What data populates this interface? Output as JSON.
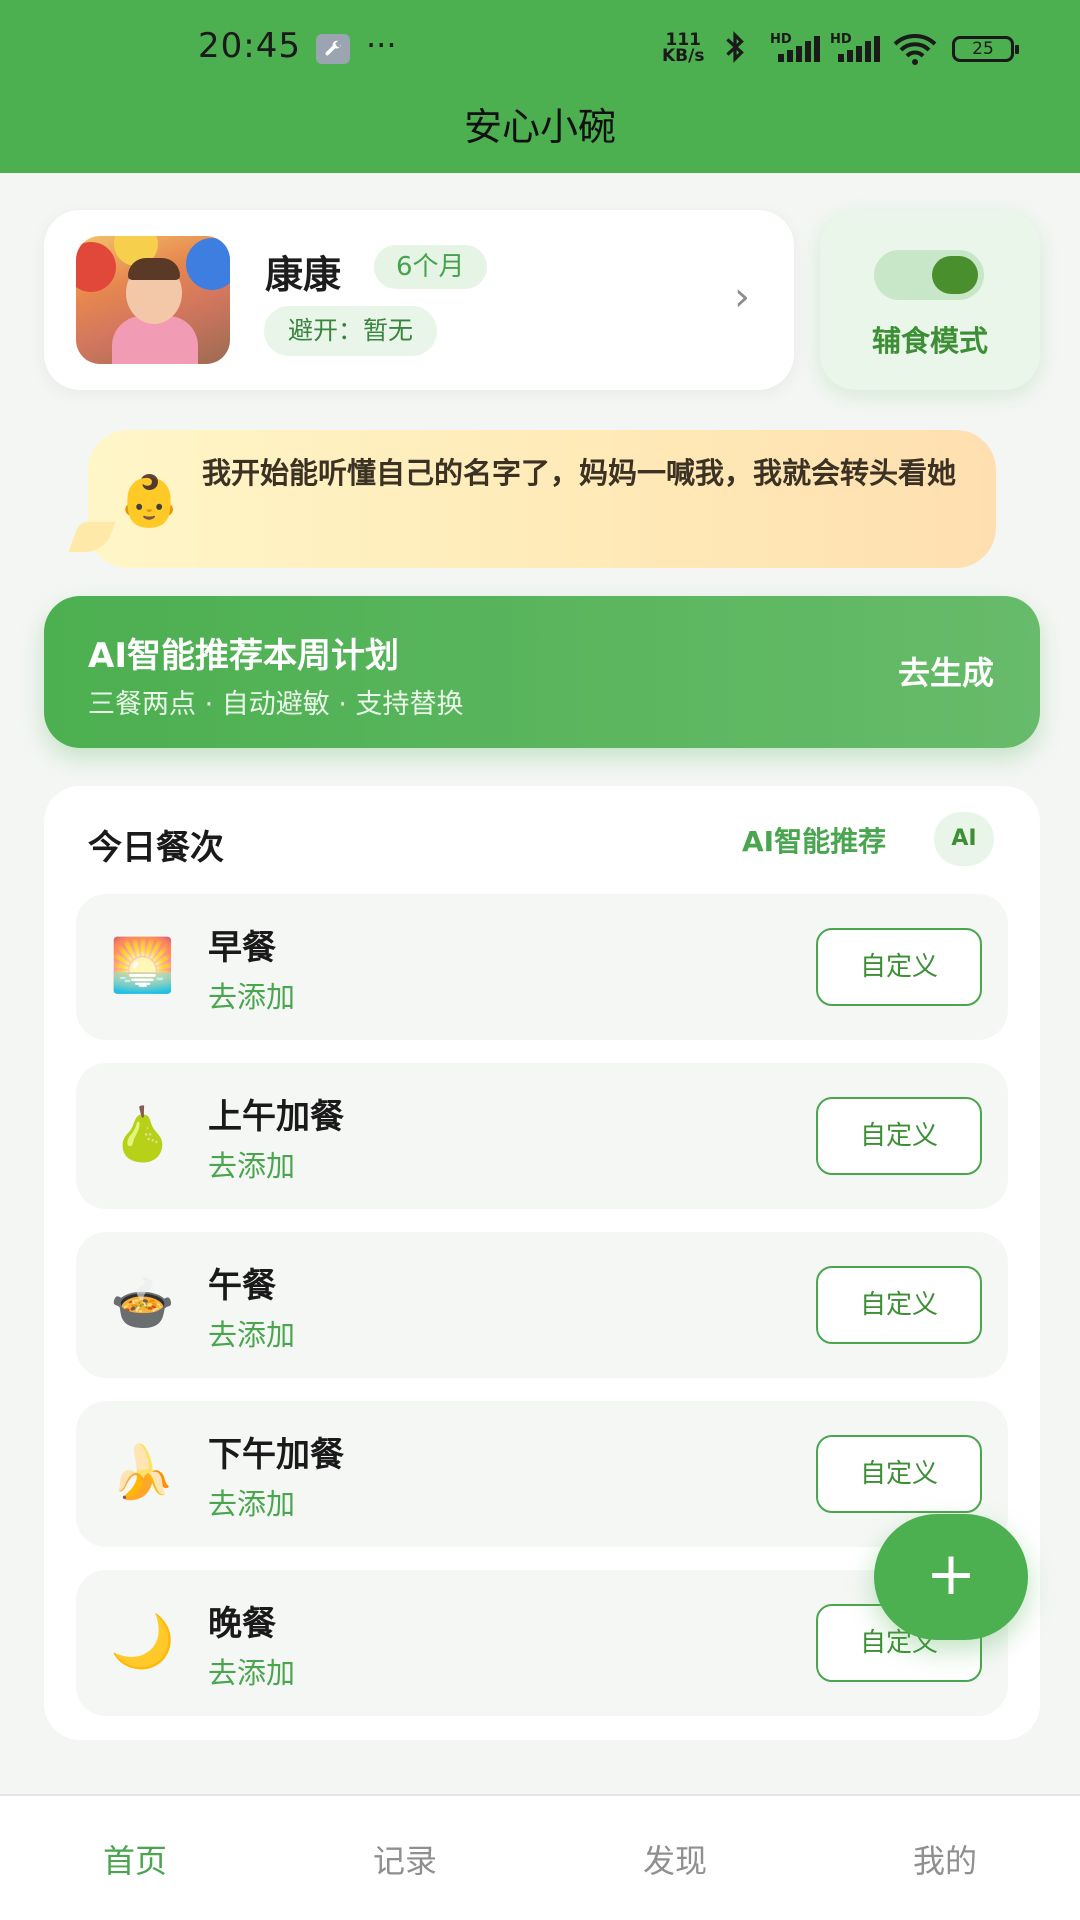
{
  "status_bar": {
    "time": "20:45",
    "more": "···",
    "net_speed_value": "111",
    "net_speed_unit": "KB/s",
    "signal_label": "HD",
    "battery": "25"
  },
  "app": {
    "title": "安心小碗"
  },
  "profile": {
    "name": "康康",
    "age": "6个月",
    "avoid": "避开：暂无",
    "chevron": "›"
  },
  "mode": {
    "label": "辅食模式",
    "enabled": true
  },
  "tip": {
    "emoji": "👶",
    "text": "我开始能听懂自己的名字了，妈妈一喊我，我就会转头看她"
  },
  "ai_banner": {
    "title": "AI智能推荐本周计划",
    "subtitle": "三餐两点 · 自动避敏 · 支持替换",
    "cta": "去生成"
  },
  "meals": {
    "heading": "今日餐次",
    "ai_link": "AI智能推荐",
    "ai_chip": "AI",
    "items": [
      {
        "icon": "🌅",
        "icon_name": "sunrise-icon",
        "name": "早餐",
        "action": "去添加",
        "custom": "自定义"
      },
      {
        "icon": "🍐",
        "icon_name": "pear-icon",
        "name": "上午加餐",
        "action": "去添加",
        "custom": "自定义"
      },
      {
        "icon": "🍲",
        "icon_name": "pot-of-food-icon",
        "name": "午餐",
        "action": "去添加",
        "custom": "自定义"
      },
      {
        "icon": "🍌",
        "icon_name": "banana-icon",
        "name": "下午加餐",
        "action": "去添加",
        "custom": "自定义"
      },
      {
        "icon": "🌙",
        "icon_name": "crescent-moon-icon",
        "name": "晚餐",
        "action": "去添加",
        "custom": "自定义"
      }
    ]
  },
  "fab": {
    "label": "+"
  },
  "nav": {
    "items": [
      {
        "label": "首页",
        "active": true
      },
      {
        "label": "记录",
        "active": false
      },
      {
        "label": "发现",
        "active": false
      },
      {
        "label": "我的",
        "active": false
      }
    ]
  },
  "colors": {
    "primary": "#4caf50",
    "primary_text": "#4aa54f",
    "tip_bg_start": "#fff6c8",
    "tip_bg_end": "#ffdfb0"
  }
}
